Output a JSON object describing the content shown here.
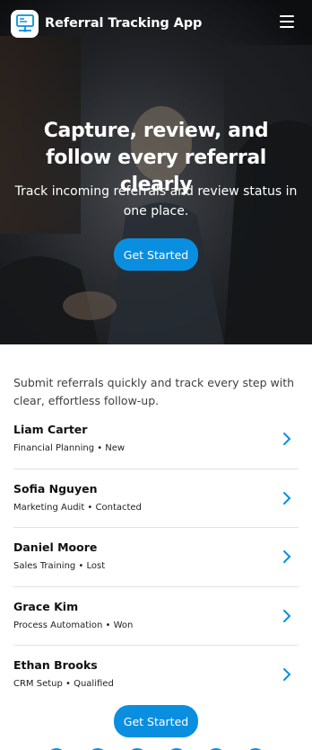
{
  "header": {
    "app_title": "Referral Tracking App",
    "logo_icon": "monitor-network-icon",
    "menu_icon": "hamburger-menu-icon"
  },
  "hero": {
    "title": "Capture, review, and follow every referral clearly",
    "subtitle": "Track incoming referrals and review status in one place.",
    "cta_label": "Get Started"
  },
  "intro": "Submit referrals quickly and track every step with clear, effortless follow-up.",
  "referrals": [
    {
      "name": "Liam Carter",
      "meta": "Financial Planning • New"
    },
    {
      "name": "Sofia Nguyen",
      "meta": "Marketing Audit • Contacted"
    },
    {
      "name": "Daniel Moore",
      "meta": "Sales Training • Lost"
    },
    {
      "name": "Grace Kim",
      "meta": "Process Automation • Won"
    },
    {
      "name": "Ethan Brooks",
      "meta": "CRM Setup • Qualified"
    }
  ],
  "bottom_cta_label": "Get Started",
  "colors": {
    "accent": "#0a8fe0",
    "hero_text": "#ffffff",
    "divider": "#e2e2e2"
  }
}
